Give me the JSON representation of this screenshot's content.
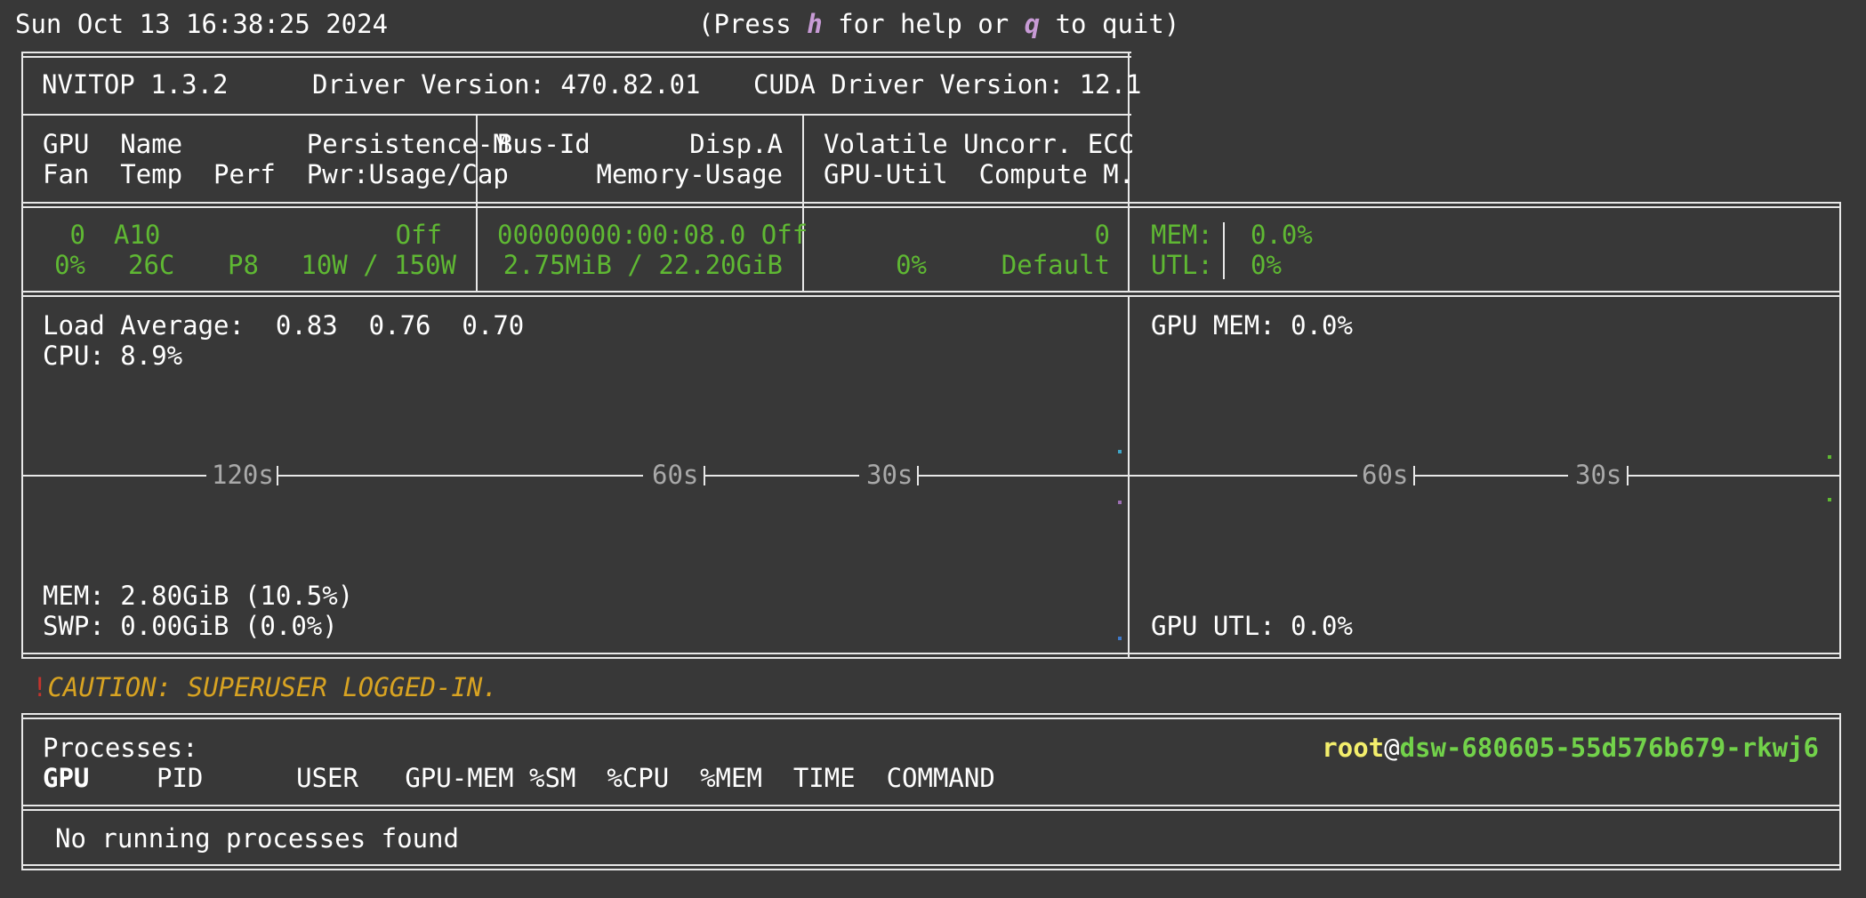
{
  "header": {
    "datetime": "Sun Oct 13 16:38:25 2024",
    "help_prefix": "(Press ",
    "help_key": "h",
    "help_mid": " for help or ",
    "quit_key": "q",
    "help_suffix": " to quit)"
  },
  "info": {
    "app": "NVITOP 1.3.2",
    "driver": "Driver Version: 470.82.01",
    "cuda": "CUDA Driver Version: 12.1"
  },
  "columns": {
    "c1_row1": "GPU  Name        Persistence-M",
    "c1_row2": "Fan  Temp  Perf  Pwr:Usage/Cap",
    "c2_row1_left": "Bus-Id",
    "c2_row1_right": "Disp.A",
    "c2_row2": "Memory-Usage",
    "c3_row1": "Volatile Uncorr. ECC",
    "c3_row2": "GPU-Util  Compute M."
  },
  "gpu": {
    "index": "0",
    "name": "A10",
    "persistence": "Off",
    "fan": "0%",
    "temp": "26C",
    "perf": "P8",
    "power": "10W / 150W",
    "bus_disp": "00000000:00:08.0 Off",
    "memory_usage": "2.75MiB / 22.20GiB",
    "ecc": "0",
    "util": "0%",
    "compute_mode": "Default",
    "mem_label": "MEM:",
    "mem_value": "0.0%",
    "utl_label": "UTL:",
    "utl_value": "0%"
  },
  "host": {
    "load_average": "Load Average:  0.83  0.76  0.70",
    "cpu": "CPU: 8.9%",
    "mem": "MEM: 2.80GiB (10.5%)",
    "swp": "SWP: 0.00GiB (0.0%)",
    "ticks_left": [
      "120s",
      "60s",
      "30s"
    ],
    "gpu_mem": "GPU MEM: 0.0%",
    "gpu_utl": "GPU UTL: 0.0%",
    "ticks_right": [
      "60s",
      "30s"
    ]
  },
  "caution": {
    "marker": "!",
    "text": "CAUTION: SUPERUSER LOGGED-IN."
  },
  "processes": {
    "title": "Processes:",
    "user": "root",
    "at": "@",
    "hostname": "dsw-680605-55d576b679-rkwj6",
    "col_gpu": "GPU",
    "columns": "PID      USER   GPU-MEM %SM  %CPU  %MEM  TIME  COMMAND",
    "empty": "No running processes found"
  },
  "colors": {
    "background": "#383838",
    "gpu_row": "#5fb833",
    "caution": "#d8a322",
    "hotkey": "#c89bd6",
    "user": "#f3ee6c",
    "hostname": "#72d24a"
  }
}
